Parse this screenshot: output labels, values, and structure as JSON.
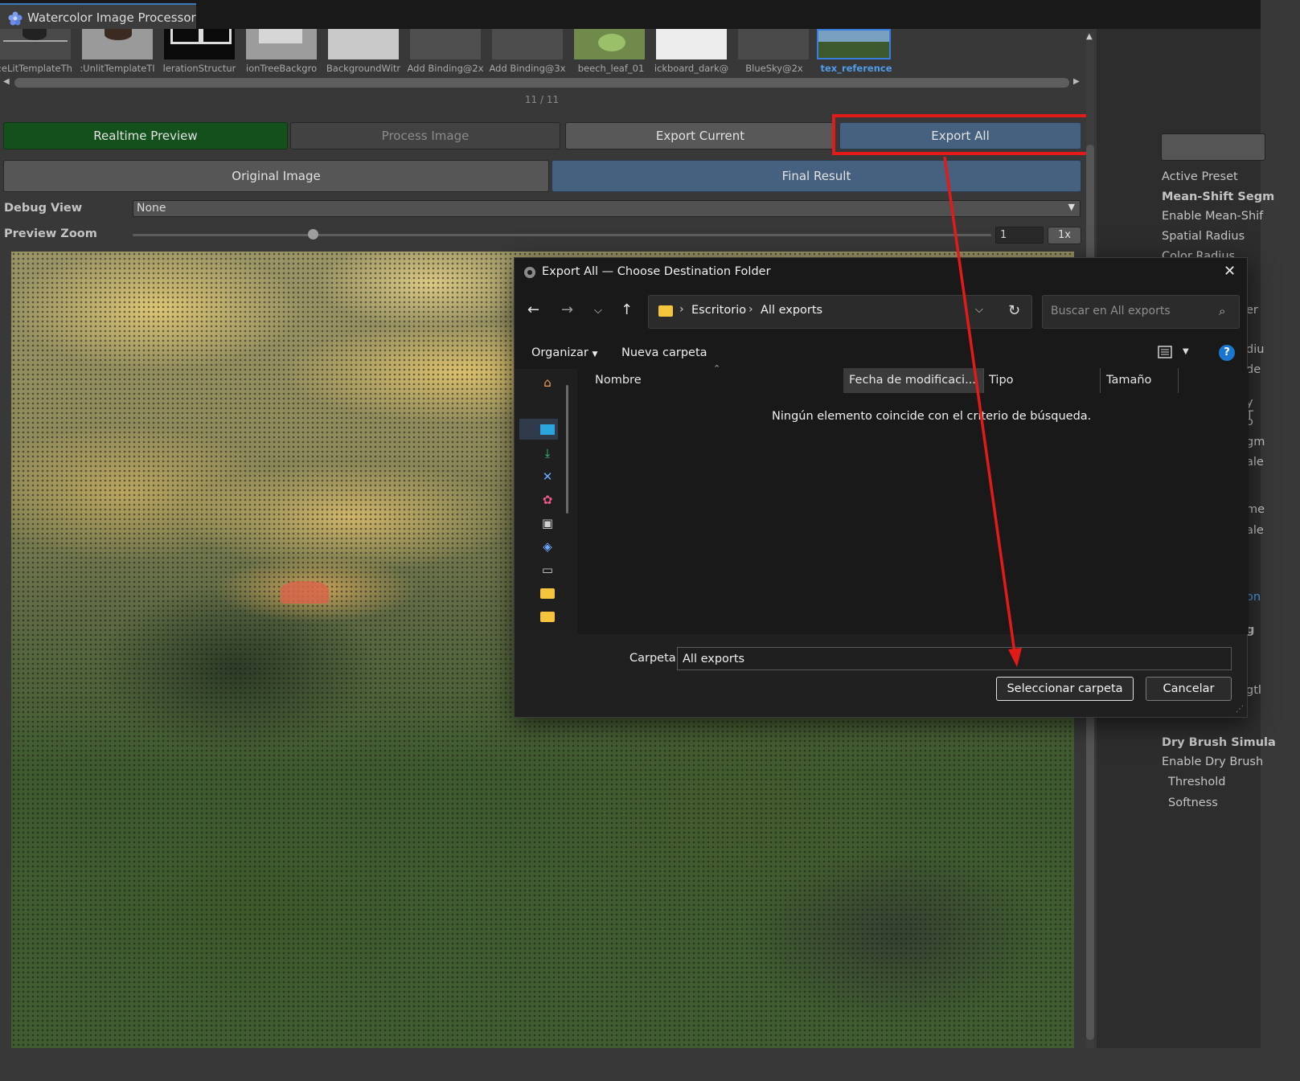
{
  "window": {
    "title": "Watercolor Image Processor"
  },
  "thumbnails": [
    {
      "label": ":eLitTemplateTh",
      "selected": false
    },
    {
      "label": ":UnlitTemplateTI",
      "selected": false
    },
    {
      "label": "lerationStructur",
      "selected": false
    },
    {
      "label": "ionTreeBackgro",
      "selected": false
    },
    {
      "label": "BackgroundWitr",
      "selected": false
    },
    {
      "label": "Add Binding@2x",
      "selected": false
    },
    {
      "label": "Add Binding@3x",
      "selected": false
    },
    {
      "label": "beech_leaf_01",
      "selected": false
    },
    {
      "label": "ickboard_dark@",
      "selected": false
    },
    {
      "label": "BlueSky@2x",
      "selected": false
    },
    {
      "label": "tex_reference",
      "selected": true
    }
  ],
  "page_counter": "11 / 11",
  "toolbar": {
    "realtime_preview": "Realtime Preview",
    "process_image": "Process Image",
    "export_current": "Export Current",
    "export_all": "Export All"
  },
  "view_toggle": {
    "original": "Original Image",
    "final": "Final Result",
    "active": "Final Result"
  },
  "debug_view": {
    "label": "Debug View",
    "value": "None"
  },
  "preview_zoom": {
    "label": "Preview Zoom",
    "value": "1",
    "button": "1x",
    "slider_fraction": 0.21
  },
  "inspector": {
    "active_preset": "Active Preset",
    "mean_shift_header": "Mean-Shift Segm",
    "enable_mean_shift": "Enable Mean-Shif",
    "spatial_radius": "Spatial Radius",
    "color_radius": "Color Radius",
    "fragments": [
      "er",
      "diu",
      "de",
      "y T",
      "o",
      "gm",
      "ale",
      "me",
      "ale",
      "on",
      "g",
      "gtl"
    ],
    "dry_brush_header": "Dry Brush Simula",
    "enable_dry_brush": "Enable Dry Brush",
    "threshold": "Threshold",
    "softness": "Softness"
  },
  "dialog": {
    "title": "Export All — Choose Destination Folder",
    "breadcrumb": [
      "Escritorio",
      "All exports"
    ],
    "search_placeholder": "Buscar en All exports",
    "organize": "Organizar",
    "new_folder": "Nueva carpeta",
    "columns": [
      "Nombre",
      "Fecha de modificaci...",
      "Tipo",
      "Tamaño"
    ],
    "empty_message": "Ningún elemento coincide con el criterio de búsqueda.",
    "folder_label": "Carpeta:",
    "folder_value": "All exports",
    "select_button": "Seleccionar carpeta",
    "cancel_button": "Cancelar",
    "help": "?"
  },
  "colors": {
    "accent_blue": "#46607f",
    "realtime_green": "#14501c",
    "highlight_red": "#e21a1a",
    "selected_thumb": "#4f9be8"
  }
}
